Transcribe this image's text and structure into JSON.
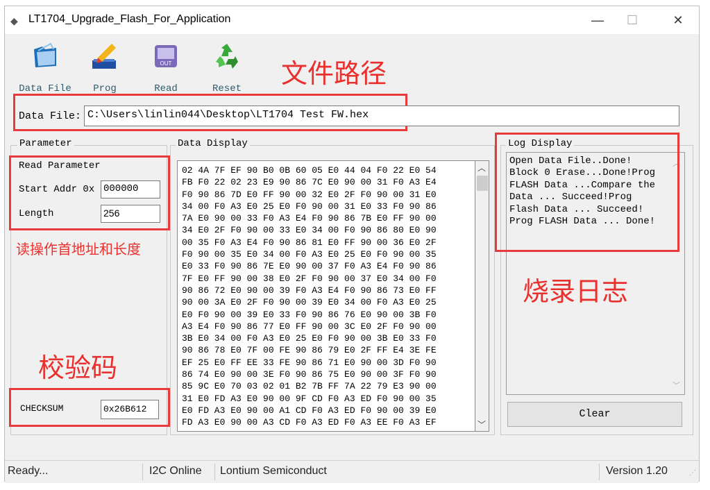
{
  "window": {
    "title": "LT1704_Upgrade_Flash_For_Application",
    "controls": {
      "minimize": "—",
      "maximize": "☐",
      "close": "✕"
    }
  },
  "toolbar": {
    "data_file": "Data File",
    "prog": "Prog",
    "read": "Read",
    "reset": "Reset",
    "read_icon_text": "OUT"
  },
  "annotations": {
    "file_path": "文件路径",
    "read_params": "读操作首地址和长度",
    "log": "烧录日志",
    "checksum": "校验码"
  },
  "data_file": {
    "label": "Data File:",
    "path": "C:\\Users\\linlin044\\Desktop\\LT1704 Test FW.hex"
  },
  "parameter": {
    "group_label": "Parameter",
    "read_parameter": "Read Parameter",
    "start_addr_label": "Start Addr 0x",
    "start_addr_value": "000000",
    "length_label": "Length",
    "length_value": "256",
    "checksum_label": "CHECKSUM",
    "checksum_value": "0x26B612"
  },
  "data_display": {
    "group_label": "Data Display",
    "lines": [
      "02 4A 7F EF 90 B0 0B 60 05 E0 44 04 F0 22 E0 54",
      "FB F0 22 02 23 E9 90 86 7C E0 90 00 31 F0 A3 E4",
      "F0 90 86 7D E0 FF 90 00 32 E0 2F F0 90 00 31 E0",
      "34 00 F0 A3 E0 25 E0 F0 90 00 31 E0 33 F0 90 86",
      "7A E0 90 00 33 F0 A3 E4 F0 90 86 7B E0 FF 90 00",
      "34 E0 2F F0 90 00 33 E0 34 00 F0 90 86 80 E0 90",
      "00 35 F0 A3 E4 F0 90 86 81 E0 FF 90 00 36 E0 2F",
      "F0 90 00 35 E0 34 00 F0 A3 E0 25 E0 F0 90 00 35",
      "E0 33 F0 90 86 7E E0 90 00 37 F0 A3 E4 F0 90 86",
      "7F E0 FF 90 00 38 E0 2F F0 90 00 37 E0 34 00 F0",
      "90 86 72 E0 90 00 39 F0 A3 E4 F0 90 86 73 E0 FF",
      "90 00 3A E0 2F F0 90 00 39 E0 34 00 F0 A3 E0 25",
      "E0 F0 90 00 39 E0 33 F0 90 86 76 E0 90 00 3B F0",
      "A3 E4 F0 90 86 77 E0 FF 90 00 3C E0 2F F0 90 00",
      "3B E0 34 00 F0 A3 E0 25 E0 F0 90 00 3B E0 33 F0",
      "90 86 78 E0 7F 00 FE 90 86 79 E0 2F FF E4 3E FE",
      "EF 25 E0 FF EE 33 FE 90 86 71 E0 90 00 3D F0 90",
      "86 74 E0 90 00 3E F0 90 86 75 E0 90 00 3F F0 90",
      "85 9C E0 70 03 02 01 B2 7B FF 7A 22 79 E3 90 00",
      "31 E0 FD A3 E0 90 00 9F CD F0 A3 ED F0 90 00 35",
      "E0 FD A3 E0 90 00 A1 CD F0 A3 ED F0 90 00 39 E0",
      "FD A3 E0 90 00 A3 CD F0 A3 ED F0 A3 EE F0 A3 EF"
    ],
    "scroll_up": "︿",
    "scroll_down": "﹀"
  },
  "log_display": {
    "group_label": "Log Display",
    "lines": [
      "Open Data File..Done!",
      "Block 0 Erase...Done!Prog",
      "FLASH Data ...Compare the",
      "Data ... Succeed!Prog",
      "Flash Data ... Succeed!",
      "Prog FLASH Data ... Done!"
    ],
    "clear_label": "Clear"
  },
  "status": {
    "ready": "Ready...",
    "i2c": "I2C Online",
    "company": "Lontium Semiconduct",
    "version": "Version 1.20"
  }
}
